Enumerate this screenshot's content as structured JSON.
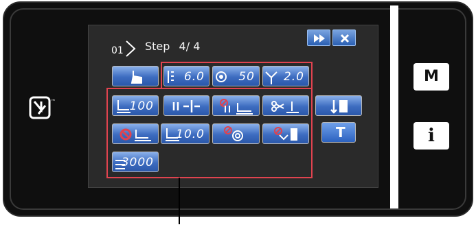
{
  "screen": {
    "step_icon_label": "01",
    "step_label": "Step",
    "step_value": "4/ 4"
  },
  "header_buttons": [
    {
      "name": "fast-forward-button",
      "icon": "fast-forward-icon"
    },
    {
      "name": "close-button",
      "icon": "close-icon"
    }
  ],
  "buttons": {
    "hand_touch": {
      "icon": "hand-pointer-icon"
    },
    "stitch_length": {
      "icon": "stitch-length-icon",
      "value": "6.0"
    },
    "thread_tension": {
      "icon": "thread-tension-icon",
      "value": "50"
    },
    "presser_lift": {
      "icon": "presser-foot-lift-icon",
      "value": "2.0"
    },
    "presser_pressure": {
      "icon": "presser-foot-pressure-icon",
      "value": "100"
    },
    "reverse_feed": {
      "icon": "reverse-stitch-icon"
    },
    "no_reverse": {
      "icon": "no-reverse-stitch-icon"
    },
    "thread_trim": {
      "icon": "thread-trim-icon"
    },
    "edge_guide": {
      "icon": "edge-guide-icon"
    },
    "no_presser": {
      "icon": "no-presser-icon"
    },
    "presser_height": {
      "icon": "presser-height-icon",
      "value": "10.0"
    },
    "no_tension": {
      "icon": "no-tension-icon"
    },
    "no_wiper": {
      "icon": "no-wiper-icon"
    },
    "t_button": {
      "label": "T"
    },
    "max_speed": {
      "icon": "max-speed-icon",
      "value": "3000"
    }
  },
  "side_buttons": [
    {
      "label": "M"
    },
    {
      "label": "i"
    }
  ],
  "colors": {
    "button_top": "#8ab0ea",
    "button_bottom": "#2b58aa",
    "highlight": "#e0434f",
    "screen_bg": "#2a2a2a"
  }
}
